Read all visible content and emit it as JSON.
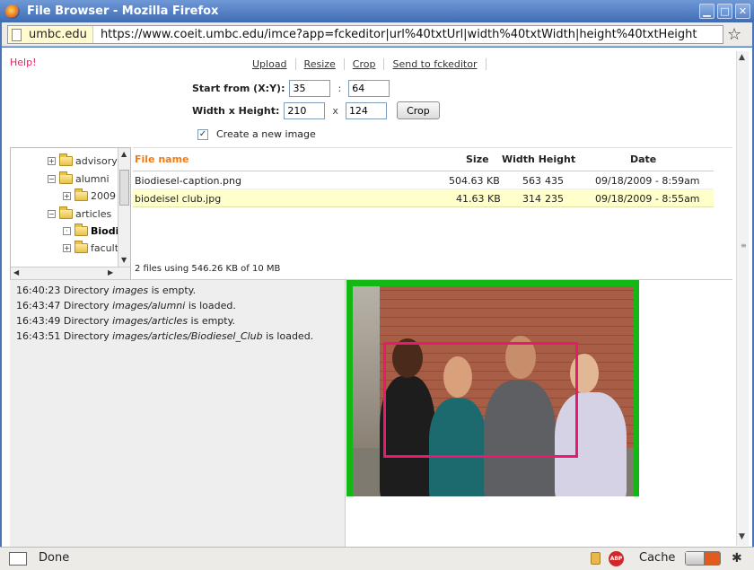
{
  "window": {
    "title": "File Browser - Mozilla Firefox",
    "controls": {
      "minimize": "▁",
      "maximize": "□",
      "close": "✕"
    }
  },
  "urlbar": {
    "site": "umbc.edu",
    "url": "https://www.coeit.umbc.edu/imce?app=fckeditor|url%40txtUrl|width%40txtWidth|height%40txtHeight",
    "star": "☆"
  },
  "help": "Help!",
  "ops": [
    "Upload",
    "Resize",
    "Crop",
    "Send to fckeditor"
  ],
  "crop_form": {
    "start_label": "Start from (X:Y):",
    "x": "35",
    "colon": ":",
    "y": "64",
    "size_label": "Width x Height:",
    "width": "210",
    "times": "x",
    "height": "124",
    "button": "Crop",
    "checkbox_label": "Create a new image",
    "checkbox_checked": true
  },
  "tree": {
    "items": [
      {
        "label": "advisory",
        "expander": "+",
        "bold": false
      },
      {
        "label": "alumni",
        "expander": "−",
        "bold": false
      },
      {
        "label": "2009",
        "expander": "+",
        "bold": false
      },
      {
        "label": "articles",
        "expander": "−",
        "bold": false
      },
      {
        "label": "Biodi",
        "expander": "·",
        "bold": true
      },
      {
        "label": "facult",
        "expander": "+",
        "bold": false
      }
    ]
  },
  "filelist": {
    "headers": {
      "name": "File name",
      "size": "Size",
      "wh": "Width Height",
      "date": "Date"
    },
    "rows": [
      {
        "name": "Biodiesel-caption.png",
        "size": "504.63 KB",
        "width": "563",
        "height": "435",
        "date": "09/18/2009 - 8:59am",
        "selected": false
      },
      {
        "name": "biodeisel club.jpg",
        "size": "41.63 KB",
        "width": "314",
        "height": "235",
        "date": "09/18/2009 - 8:55am",
        "selected": true
      }
    ],
    "status_pre": "2 files using ",
    "status_used": "546.26 KB",
    "status_mid": " of ",
    "status_total": "10 MB"
  },
  "log": [
    {
      "time": "16:40:23",
      "pre": "Directory ",
      "path": "images",
      "post": " is empty."
    },
    {
      "time": "16:43:47",
      "pre": "Directory ",
      "path": "images/alumni",
      "post": " is loaded."
    },
    {
      "time": "16:43:49",
      "pre": "Directory ",
      "path": "images/articles",
      "post": " is empty."
    },
    {
      "time": "16:43:51",
      "pre": "Directory ",
      "path": "images/articles/Biodiesel_Club",
      "post": " is loaded."
    }
  ],
  "statusbar": {
    "done": "Done",
    "adblock": "ABP",
    "cache_label": "Cache"
  },
  "colors": {
    "accent_orange": "#f27c12",
    "help_pink": "#e0245e",
    "crop_frame": "#e8196e",
    "photo_border": "#14b814"
  }
}
